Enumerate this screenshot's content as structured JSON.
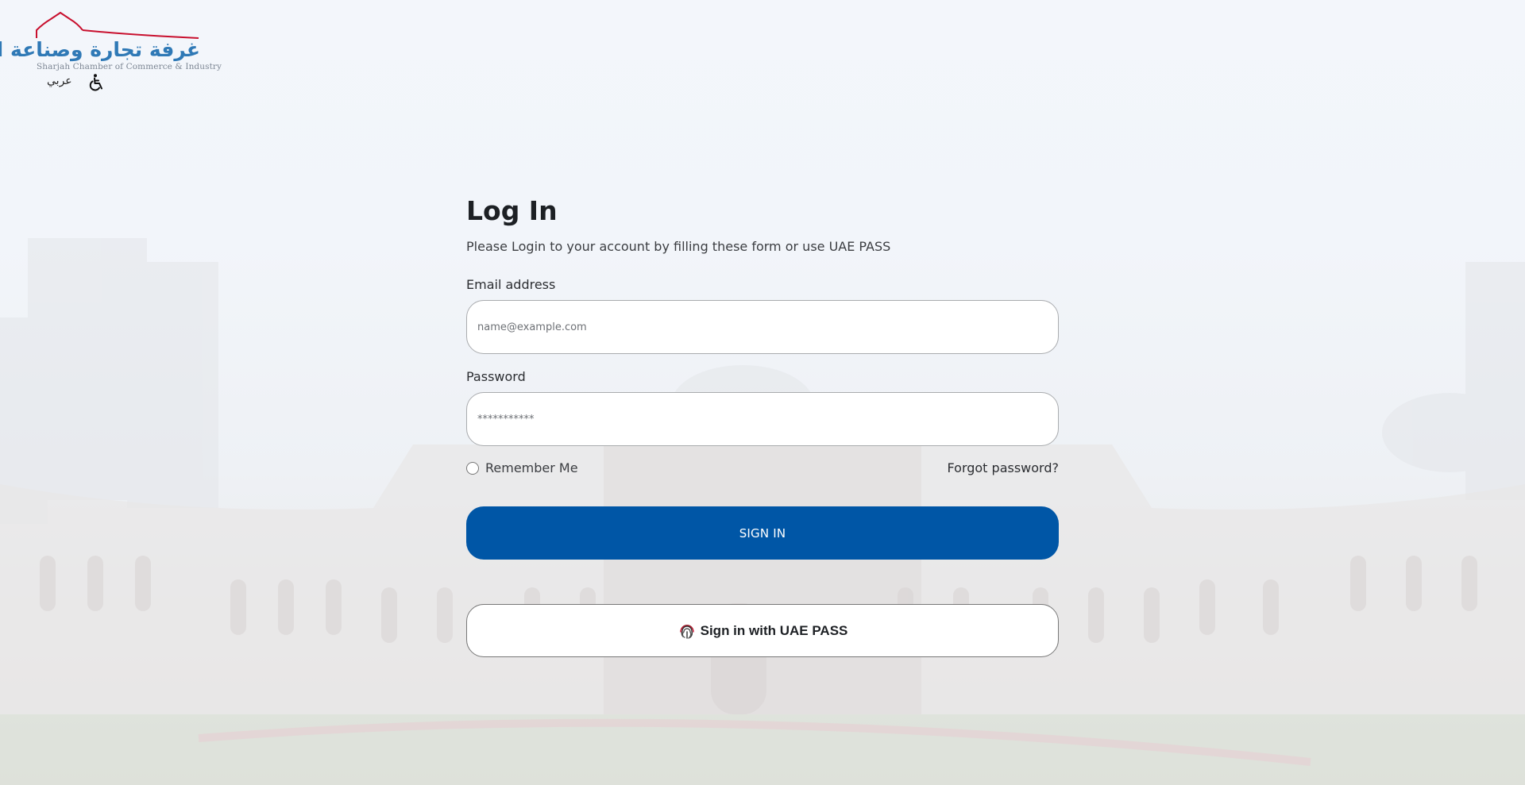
{
  "header": {
    "logo_arabic": "غرفة تجارة وصناعة الشارقة",
    "logo_english": "Sharjah Chamber of Commerce & Industry",
    "language_link": "عربي",
    "accessibility_icon": "wheelchair-icon"
  },
  "login": {
    "title": "Log In",
    "subtitle": "Please Login to your account by filling these form or use UAE PASS",
    "email_label": "Email address",
    "email_placeholder": "name@example.com",
    "email_value": "",
    "password_label": "Password",
    "password_placeholder": "***********",
    "password_value": "",
    "remember_label": "Remember Me",
    "remember_checked": false,
    "forgot_label": "Forgot password?",
    "signin_label": "SIGN IN",
    "uaepass_label": "Sign in with UAE PASS",
    "uaepass_icon": "fingerprint-icon"
  },
  "colors": {
    "primary_button": "#0056a6",
    "logo_blue": "#2f79b6",
    "logo_red": "#c8102e"
  }
}
